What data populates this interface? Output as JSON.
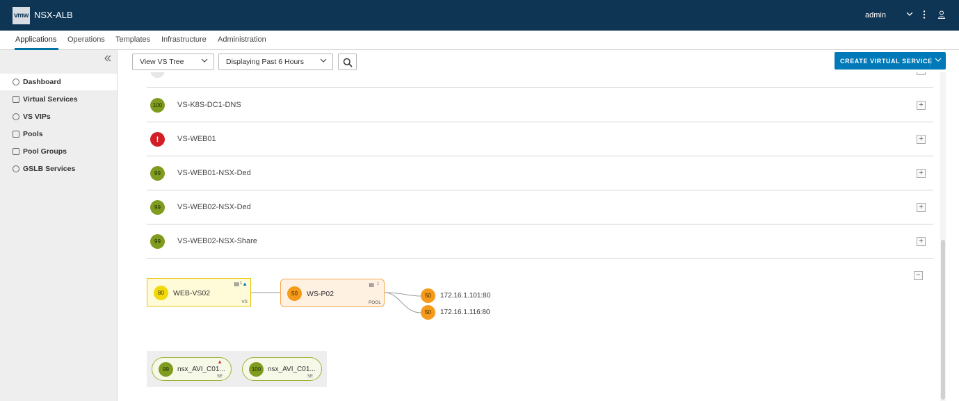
{
  "header": {
    "logo": "vmw",
    "title": "NSX-ALB",
    "user": "admin",
    "icons": [
      "chevron-down-icon",
      "kebab-menu-icon",
      "user-icon"
    ]
  },
  "nav": {
    "tabs": [
      {
        "label": "Applications",
        "active": true
      },
      {
        "label": "Operations"
      },
      {
        "label": "Templates"
      },
      {
        "label": "Infrastructure"
      },
      {
        "label": "Administration"
      }
    ]
  },
  "sidebar": {
    "items": [
      {
        "label": "Dashboard",
        "icon": "dashboard-icon",
        "active": true
      },
      {
        "label": "Virtual Services",
        "icon": "virtual-services-icon"
      },
      {
        "label": "VS VIPs",
        "icon": "map-pin-icon"
      },
      {
        "label": "Pools",
        "icon": "pools-icon"
      },
      {
        "label": "Pool Groups",
        "icon": "pool-groups-icon"
      },
      {
        "label": "GSLB Services",
        "icon": "globe-icon"
      }
    ]
  },
  "toolbar": {
    "view_select": "View VS Tree",
    "time_select": "Displaying Past 6 Hours",
    "create_button": "CREATE VIRTUAL SERVICE"
  },
  "colors": {
    "header_bg": "#0f3554",
    "accent": "#0079b8",
    "health_green": "#7f9c1f",
    "health_red": "#d21f26",
    "health_yellow": "#f2d806",
    "health_orange": "#f59a1b"
  },
  "virtual_services": [
    {
      "score": "100",
      "name": "VS-K8S-DC1-DNS",
      "status": "green"
    },
    {
      "score": "!",
      "name": "VS-WEB01",
      "status": "red"
    },
    {
      "score": "99",
      "name": "VS-WEB01-NSX-Ded",
      "status": "green"
    },
    {
      "score": "99",
      "name": "VS-WEB02-NSX-Ded",
      "status": "green"
    },
    {
      "score": "99",
      "name": "VS-WEB02-NSX-Share",
      "status": "green"
    }
  ],
  "tree": {
    "vs": {
      "score": "80",
      "name": "WEB-VS02",
      "type": "VS",
      "count": "1"
    },
    "pool": {
      "score": "50",
      "name": "WS-P02",
      "type": "POOL",
      "count": "2"
    },
    "servers": [
      {
        "score": "50",
        "address": "172.16.1.101:80"
      },
      {
        "score": "50",
        "address": "172.16.1.116:80"
      }
    ],
    "service_engines": [
      {
        "score": "99",
        "name": "nsx_AVI_C01...",
        "type": "SE",
        "alert": true
      },
      {
        "score": "100",
        "name": "nsx_AVI_C01...",
        "type": "SE",
        "alert": false
      }
    ]
  }
}
